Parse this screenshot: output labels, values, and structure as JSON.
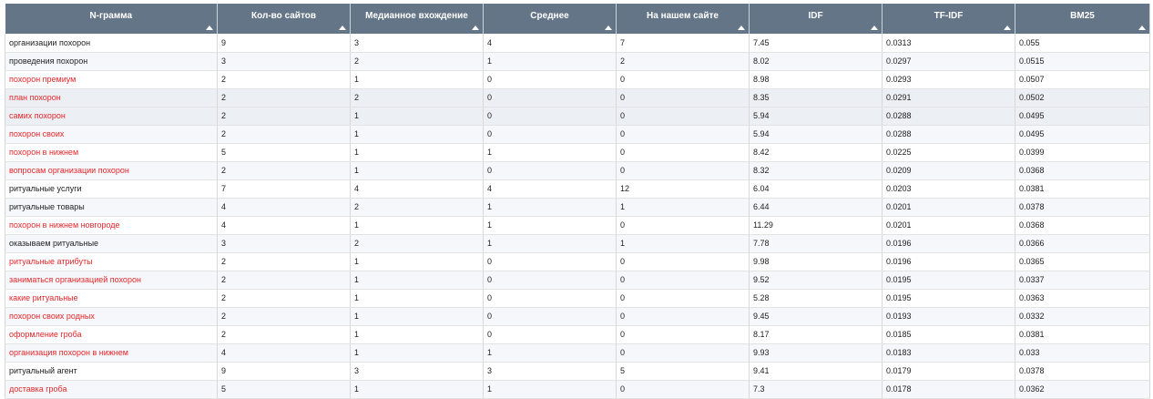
{
  "columns": [
    "N-грамма",
    "Кол-во сайтов",
    "Медианное вхождение",
    "Среднее",
    "На нашем сайте",
    "IDF",
    "TF-IDF",
    "BM25"
  ],
  "colors": {
    "header_bg": "#647587",
    "highlight_text": "#e5262a"
  },
  "rows": [
    {
      "cells": [
        "организации похорон",
        "9",
        "3",
        "4",
        "7",
        "7.45",
        "0.0313",
        "0.055"
      ],
      "red": false
    },
    {
      "cells": [
        "проведения похорон",
        "3",
        "2",
        "1",
        "2",
        "8.02",
        "0.0297",
        "0.0515"
      ],
      "red": false
    },
    {
      "cells": [
        "похорон премиум",
        "2",
        "1",
        "0",
        "0",
        "8.98",
        "0.0293",
        "0.0507"
      ],
      "red": true
    },
    {
      "cells": [
        "план похорон",
        "2",
        "2",
        "0",
        "0",
        "8.35",
        "0.0291",
        "0.0502"
      ],
      "red": true
    },
    {
      "cells": [
        "самих похорон",
        "2",
        "1",
        "0",
        "0",
        "5.94",
        "0.0288",
        "0.0495"
      ],
      "red": true
    },
    {
      "cells": [
        "похорон своих",
        "2",
        "1",
        "0",
        "0",
        "5.94",
        "0.0288",
        "0.0495"
      ],
      "red": true
    },
    {
      "cells": [
        "похорон в нижнем",
        "5",
        "1",
        "1",
        "0",
        "8.42",
        "0.0225",
        "0.0399"
      ],
      "red": true
    },
    {
      "cells": [
        "вопросам организации похорон",
        "2",
        "1",
        "0",
        "0",
        "8.32",
        "0.0209",
        "0.0368"
      ],
      "red": true
    },
    {
      "cells": [
        "ритуальные услуги",
        "7",
        "4",
        "4",
        "12",
        "6.04",
        "0.0203",
        "0.0381"
      ],
      "red": false
    },
    {
      "cells": [
        "ритуальные товары",
        "4",
        "2",
        "1",
        "1",
        "6.44",
        "0.0201",
        "0.0378"
      ],
      "red": false
    },
    {
      "cells": [
        "похорон в нижнем новгороде",
        "4",
        "1",
        "1",
        "0",
        "11.29",
        "0.0201",
        "0.0368"
      ],
      "red": true
    },
    {
      "cells": [
        "оказываем ритуальные",
        "3",
        "2",
        "1",
        "1",
        "7.78",
        "0.0196",
        "0.0366"
      ],
      "red": false
    },
    {
      "cells": [
        "ритуальные атрибуты",
        "2",
        "1",
        "0",
        "0",
        "9.98",
        "0.0196",
        "0.0365"
      ],
      "red": true
    },
    {
      "cells": [
        "заниматься организацией похорон",
        "2",
        "1",
        "0",
        "0",
        "9.52",
        "0.0195",
        "0.0337"
      ],
      "red": true
    },
    {
      "cells": [
        "какие ритуальные",
        "2",
        "1",
        "0",
        "0",
        "5.28",
        "0.0195",
        "0.0363"
      ],
      "red": true
    },
    {
      "cells": [
        "похорон своих родных",
        "2",
        "1",
        "0",
        "0",
        "9.45",
        "0.0193",
        "0.0332"
      ],
      "red": true
    },
    {
      "cells": [
        "оформление гроба",
        "2",
        "1",
        "0",
        "0",
        "8.17",
        "0.0185",
        "0.0381"
      ],
      "red": true
    },
    {
      "cells": [
        "организация похорон в нижнем",
        "4",
        "1",
        "1",
        "0",
        "9.93",
        "0.0183",
        "0.033"
      ],
      "red": true
    },
    {
      "cells": [
        "ритуальный агент",
        "9",
        "3",
        "3",
        "5",
        "9.41",
        "0.0179",
        "0.0378"
      ],
      "red": false
    },
    {
      "cells": [
        "доставка гроба",
        "5",
        "1",
        "1",
        "0",
        "7.3",
        "0.0178",
        "0.0362"
      ],
      "red": true
    }
  ]
}
